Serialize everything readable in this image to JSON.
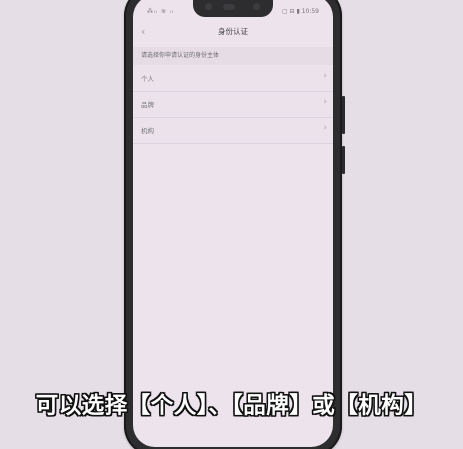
{
  "statusbar": {
    "left": "⁂ᵢₗ ≋ ᵢₗ",
    "right": "▢ ⊟ ▮ 10:59"
  },
  "navbar": {
    "back_icon": "‹",
    "title": "身份认证"
  },
  "hint": "请选择你申请认证的身份主体",
  "list": {
    "items": [
      {
        "label": "个人",
        "chevron": "›"
      },
      {
        "label": "品牌",
        "chevron": "›"
      },
      {
        "label": "机构",
        "chevron": "›"
      }
    ]
  },
  "caption": "可以选择【个人】、【品牌】或【机构】"
}
